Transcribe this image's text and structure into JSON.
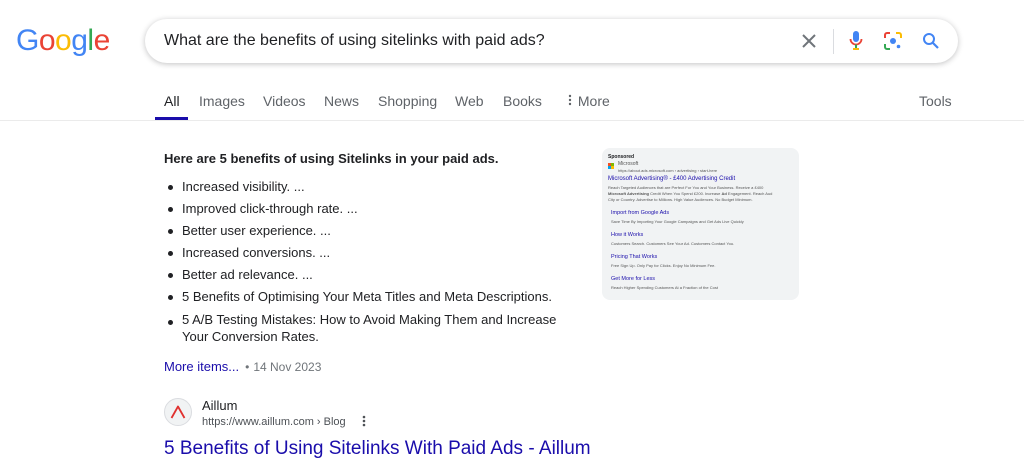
{
  "logo": {
    "letters": [
      "G",
      "o",
      "o",
      "g",
      "l",
      "e"
    ],
    "colors": [
      "#4285f4",
      "#ea4335",
      "#fbbc05",
      "#4285f4",
      "#34a853",
      "#ea4335"
    ]
  },
  "search": {
    "query": "What are the benefits of using sitelinks with paid ads?",
    "icons": [
      "close-icon",
      "mic-icon",
      "lens-icon",
      "search-icon"
    ]
  },
  "tabs": [
    {
      "label": "All",
      "active": true
    },
    {
      "label": "Images"
    },
    {
      "label": "Videos"
    },
    {
      "label": "News"
    },
    {
      "label": "Shopping"
    },
    {
      "label": "Web"
    },
    {
      "label": "Books"
    },
    {
      "label": "More"
    },
    {
      "label": "Tools"
    }
  ],
  "snippet": {
    "heading": "Here are 5 benefits of using Sitelinks in your paid ads.",
    "items": [
      "Increased visibility. ...",
      "Improved click-through rate. ...",
      "Better user experience. ...",
      "Increased conversions. ...",
      "Better ad relevance. ...",
      "5 Benefits of Optimising Your Meta Titles and Meta Descriptions.",
      "5 A/B Testing Mistakes: How to Avoid Making Them and Increase Your Conversion Rates."
    ],
    "more_items": "More items...",
    "separator": "•",
    "date": "14 Nov 2023"
  },
  "ad_card": {
    "sponsored": "Sponsored",
    "advertiser": "Microsoft",
    "url": "https://about.ads.microsoft.com › advertising › start-here",
    "title": "Microsoft Advertising® - £400 Advertising Credit",
    "desc1": "Reach Targeted Audiences that are Perfect For You and Your Business. Receive a £400",
    "desc2_bold1": "Microsoft Advertising",
    "desc2_mid": " Credit When You Spend £200. Increase ",
    "desc2_bold2": "Ad",
    "desc2_end": " Engagement. Reach Aud",
    "desc3": "City or Country. Advertise to Millions. High Value Audiences. No Budget Minimum.",
    "sitelinks": [
      {
        "title": "Import from Google Ads",
        "desc": "Save Time By Importing Your Google Campaigns and Get Ads Live Quickly"
      },
      {
        "title": "How it Works",
        "desc": "Customers Search. Customers See Your Ad. Customers Contact You."
      },
      {
        "title": "Pricing That Works",
        "desc": "Free Sign Up. Only Pay for Clicks. Enjoy No Minimum Fee."
      },
      {
        "title": "Get More for Less",
        "desc": "Reach Higher Spending Customers At a Fraction of the Cost"
      }
    ]
  },
  "result": {
    "site_name": "Aillum",
    "url": "https://www.aillum.com › Blog",
    "title": "5 Benefits of Using Sitelinks With Paid Ads - Aillum"
  },
  "colors": {
    "link": "#1a0dab",
    "accent_tab": "#1a0dab",
    "text_secondary": "#5f6368"
  }
}
